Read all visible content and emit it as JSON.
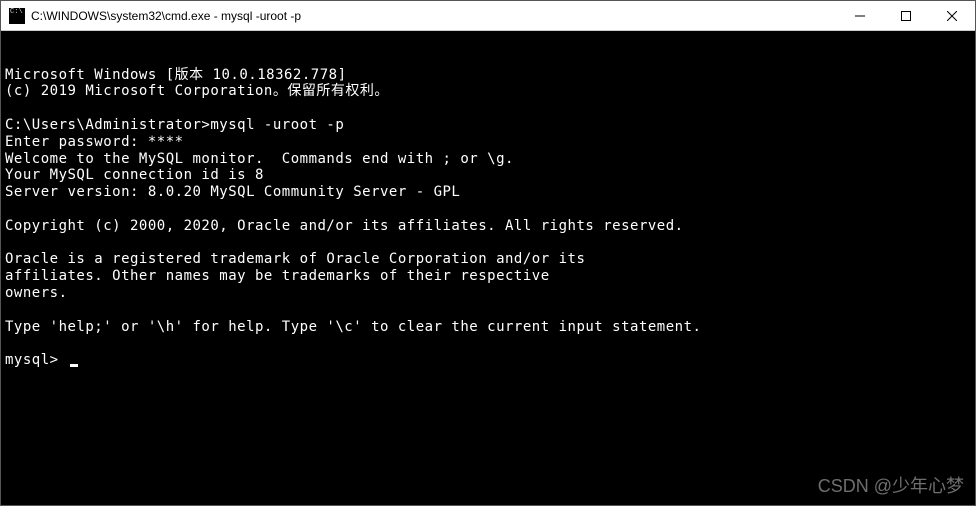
{
  "titlebar": {
    "icon_name": "cmd-icon",
    "title": "C:\\WINDOWS\\system32\\cmd.exe - mysql  -uroot -p"
  },
  "terminal": {
    "lines": [
      "Microsoft Windows [版本 10.0.18362.778]",
      "(c) 2019 Microsoft Corporation。保留所有权利。",
      "",
      "C:\\Users\\Administrator>mysql -uroot -p",
      "Enter password: ****",
      "Welcome to the MySQL monitor.  Commands end with ; or \\g.",
      "Your MySQL connection id is 8",
      "Server version: 8.0.20 MySQL Community Server - GPL",
      "",
      "Copyright (c) 2000, 2020, Oracle and/or its affiliates. All rights reserved.",
      "",
      "Oracle is a registered trademark of Oracle Corporation and/or its",
      "affiliates. Other names may be trademarks of their respective",
      "owners.",
      "",
      "Type 'help;' or '\\h' for help. Type '\\c' to clear the current input statement.",
      ""
    ],
    "prompt": "mysql> "
  },
  "watermark": "CSDN @少年心梦"
}
